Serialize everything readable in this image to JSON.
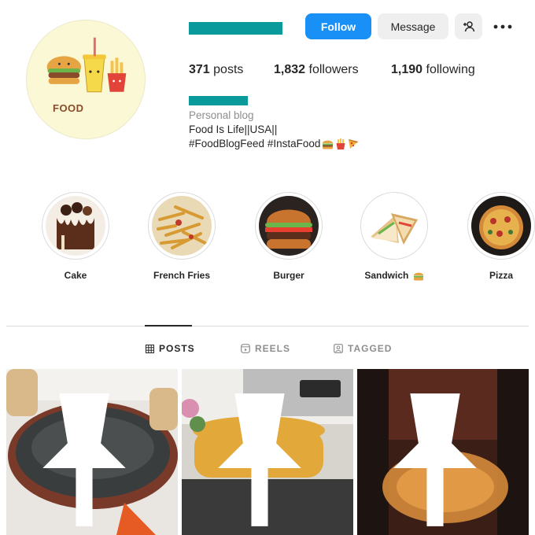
{
  "profile": {
    "avatar_text": "FOOD",
    "follow_label": "Follow",
    "message_label": "Message",
    "add_user_icon": "add-user-icon",
    "more_icon": "more-options-icon"
  },
  "stats": {
    "posts_count": "371",
    "posts_label": "posts",
    "followers_count": "1,832",
    "followers_label": "followers",
    "following_count": "1,190",
    "following_label": "following"
  },
  "bio": {
    "category": "Personal blog",
    "line1": "Food Is Life||USA||",
    "line2": "#FoodBlogFeed #InstaFood"
  },
  "highlights": [
    {
      "label": "Cake"
    },
    {
      "label": "French Fries"
    },
    {
      "label": "Burger"
    },
    {
      "label": "Sandwich"
    },
    {
      "label": "Pizza"
    }
  ],
  "tabs": [
    {
      "label": "POSTS",
      "icon": "grid-icon",
      "active": true
    },
    {
      "label": "REELS",
      "icon": "reels-icon",
      "active": false
    },
    {
      "label": "TAGGED",
      "icon": "tagged-icon",
      "active": false
    }
  ],
  "posts": [
    {
      "pinned": true
    },
    {
      "pinned": true
    },
    {
      "pinned": true
    }
  ],
  "colors": {
    "accent": "#1890f5",
    "redacted": "#0a9a9c",
    "avatar_bg": "#fbf8d6"
  }
}
